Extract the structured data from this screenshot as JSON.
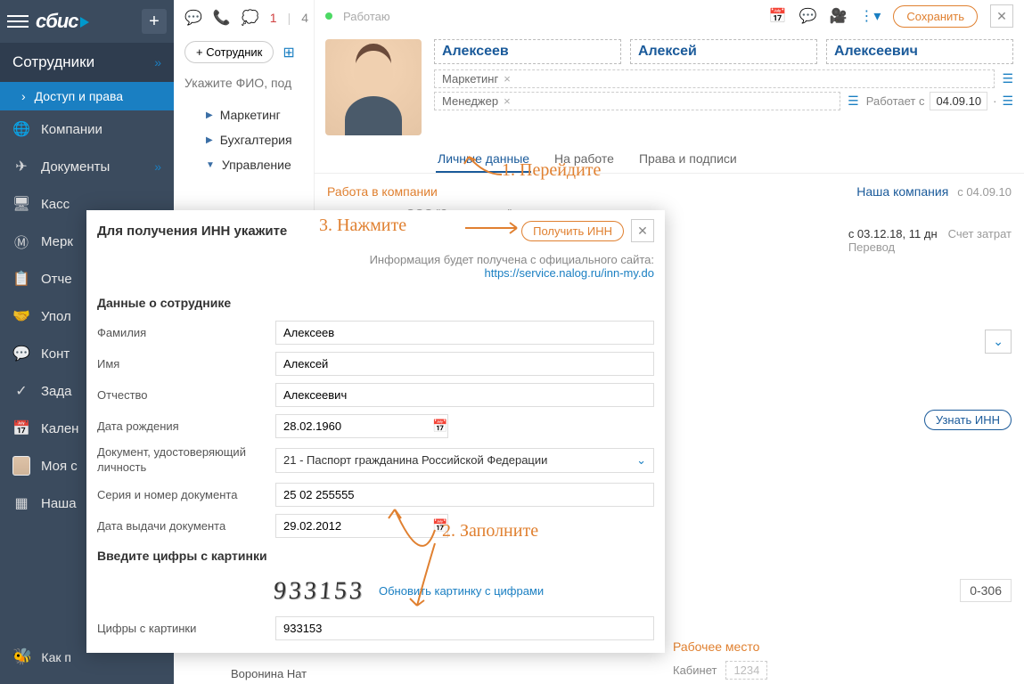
{
  "sidebar": {
    "logo": "сбис",
    "header": "Сотрудники",
    "sub": "Доступ и права",
    "items": [
      {
        "icon": "🌐",
        "label": "Компании"
      },
      {
        "icon": "✈",
        "label": "Документы",
        "chev": true
      },
      {
        "icon": "🖥",
        "label": "Касс"
      },
      {
        "icon": "Ⓜ",
        "label": "Мерк"
      },
      {
        "icon": "📋",
        "label": "Отче"
      },
      {
        "icon": "🤝",
        "label": "Упол"
      },
      {
        "icon": "💬",
        "label": "Конт"
      },
      {
        "icon": "✓",
        "label": "Зада"
      },
      {
        "icon": "📅",
        "label": "Кален"
      },
      {
        "icon": "avatar",
        "label": "Моя с"
      },
      {
        "icon": "▦",
        "label": "Наша"
      }
    ],
    "how": "Как п"
  },
  "toolbar": {
    "count1": "1",
    "count2": "4"
  },
  "subToolbar": {
    "addEmployee": "+ Сотрудник",
    "searchPlaceholder": "Укажите ФИО, под"
  },
  "depts": [
    {
      "label": "Маркетинг",
      "arrow": "▶"
    },
    {
      "label": "Бухгалтерия",
      "arrow": "▶"
    },
    {
      "label": "Управление",
      "arrow": "▼"
    }
  ],
  "lastRow": "Воронина Нат",
  "emp": {
    "status": "Работаю",
    "save": "Сохранить",
    "lastname": "Алексеев",
    "firstname": "Алексей",
    "patronymic": "Алексеевич",
    "dept": "Маркетинг",
    "role": "Менеджер",
    "worksFrom": "Работает с",
    "worksDate": "04.09.10",
    "tabs": [
      "Личные данные",
      "На работе",
      "Права и подписи"
    ],
    "companyLabel": "Работа в компании",
    "companyName": "Наша компания",
    "companyDate": "с 04.09.10",
    "orgName": "ООО \"Золотое дно\"",
    "statusDate": "с 03.12.18, 11 дн",
    "statusKind": "Перевод",
    "costLabel": "Счет затрат",
    "knowInn": "Узнать ИНН",
    "room": "0-306",
    "workplace": "Рабочее место",
    "cabinet": "Кабинет",
    "cabinetPh": "1234"
  },
  "modal": {
    "title": "Для получения ИНН укажите",
    "getInn": "Получить ИНН",
    "infoText": "Информация будет получена с официального сайта:",
    "infoLink": "https://service.nalog.ru/inn-my.do",
    "section1": "Данные о сотруднике",
    "fields": {
      "lastname": {
        "label": "Фамилия",
        "value": "Алексеев"
      },
      "firstname": {
        "label": "Имя",
        "value": "Алексей"
      },
      "patronymic": {
        "label": "Отчество",
        "value": "Алексеевич"
      },
      "dob": {
        "label": "Дата рождения",
        "value": "28.02.1960"
      },
      "doc": {
        "label": "Документ, удостоверяющий личность",
        "value": "21 - Паспорт гражданина Российской Федерации"
      },
      "serial": {
        "label": "Серия и номер документа",
        "value": "25 02 255555"
      },
      "issued": {
        "label": "Дата выдачи документа",
        "value": "29.02.2012"
      }
    },
    "captchaSection": "Введите цифры с картинки",
    "captchaValue": "933153",
    "refresh": "Обновить картинку с цифрами",
    "captchaLabel": "Цифры с картинки",
    "captchaInput": "933153"
  },
  "anno": {
    "a1": "1. Перейдите",
    "a2": "2. Заполните",
    "a3": "3. Нажмите"
  }
}
